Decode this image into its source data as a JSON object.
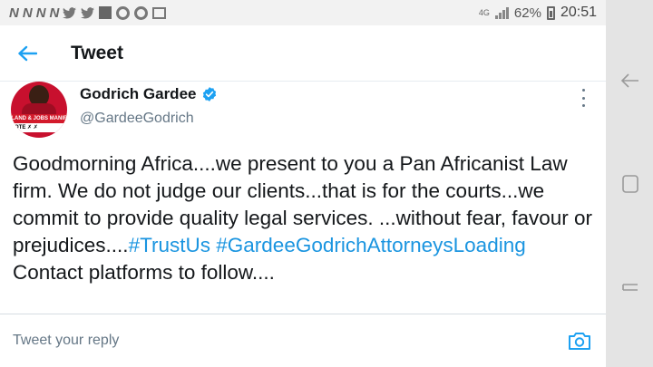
{
  "status_bar": {
    "time": "20:51",
    "battery": "62%",
    "network": "4G",
    "icons": [
      "n-icon",
      "n-icon",
      "n-icon",
      "n-icon",
      "twitter-icon",
      "twitter-icon",
      "square-icon",
      "chrome-icon",
      "chrome-icon",
      "image-icon"
    ]
  },
  "header": {
    "title": "Tweet",
    "back_icon": "arrow-left-icon"
  },
  "tweet": {
    "author_name": "Godrich Gardee",
    "handle": "@GardeeGodrich",
    "verified": true,
    "avatar_banner": "LAND & JOBS MANIF",
    "avatar_ballot": "OTE",
    "text_before": "Goodmorning Africa....we present to you a Pan Africanist Law firm. We do not judge our clients...that is for the courts...we commit to provide quality legal services. ...without fear, favour or prejudices....",
    "hashtag_1": "#TrustUs",
    "hashtag_2": "#GardeeGodrichAttorneysLoading",
    "text_after": " Contact platforms to follow...."
  },
  "reply": {
    "placeholder": "Tweet your reply",
    "camera_icon": "camera-icon"
  },
  "nav_bar": {
    "buttons": [
      "back-nav-icon",
      "home-nav-icon",
      "recents-nav-icon"
    ]
  },
  "colors": {
    "accent": "#1da1f2",
    "hashtag": "#1b95e0",
    "text": "#14171a",
    "secondary": "#657786",
    "avatar_red": "#c8102e"
  }
}
